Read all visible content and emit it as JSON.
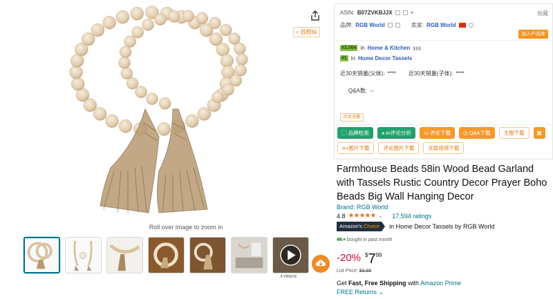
{
  "gallery": {
    "zoom_hint": "Roll over image to zoom in",
    "find_similar": "找相似",
    "video_count_label": "6 VIDEOS",
    "thumbnails": [
      "beads-coil",
      "beads-hanging",
      "beads-closeup",
      "beads-table",
      "beads-tassels",
      "room-interior",
      "video"
    ]
  },
  "panel": {
    "asin_label": "ASIN:",
    "asin": "B07ZVKBJJX",
    "collect": "收藏",
    "brand_label": "品牌:",
    "brand": "RGB World",
    "seller_label": "卖家:",
    "seller": "RGB World",
    "add_product": "加入产品库",
    "rank1": "#3,564",
    "rank1_in": "in",
    "rank1_cat": "Home & Kitchen",
    "rank2": "#1",
    "rank2_in": "in",
    "rank2_cat": "Home Decor Tassels",
    "sales_parent_label": "近30天销量(父体):",
    "sales_parent": "****",
    "sales_child_label": "近30天销量(子体):",
    "sales_child": "****",
    "qa_label": "Q&A数:",
    "qa_value": "--",
    "history": "历史消量",
    "buttons_row1": [
      "品牌检测",
      "AI评论分析",
      "评论下载",
      "Q&A下载",
      "主图下载"
    ],
    "buttons_row2": [
      "A+图片下载",
      "评论图片下载",
      "关联视频下载"
    ]
  },
  "product": {
    "title": "Farmhouse Beads 58in Wood Bead Garland with Tassels Rustic Country Decor Prayer Boho Beads Big Wall Hanging Decor",
    "brand_link": "Brand: RGB World",
    "rating": "4.8",
    "stars": "★★★★★",
    "ratings_count": "17,594 ratings",
    "choice_amazons": "Amazon's",
    "choice_word": "Choice",
    "choice_text": "in Home Decor Tassels by RGB World",
    "bought_bold": "4K+",
    "bought_text": "bought in past month",
    "discount": "-20%",
    "price_symbol": "$",
    "price_whole": "7",
    "price_fraction": "99",
    "list_price_label": "List Price:",
    "list_price": "$9.99",
    "shipping_prefix": "Get",
    "shipping_bold": "Fast, Free Shipping",
    "shipping_with": "with",
    "shipping_link": "Amazon Prime",
    "returns": "FREE Returns"
  },
  "colors": {
    "accent_orange": "#f39a2b",
    "accent_green": "#22a06b",
    "link_teal": "#007185",
    "deal_red": "#cc0c39"
  }
}
